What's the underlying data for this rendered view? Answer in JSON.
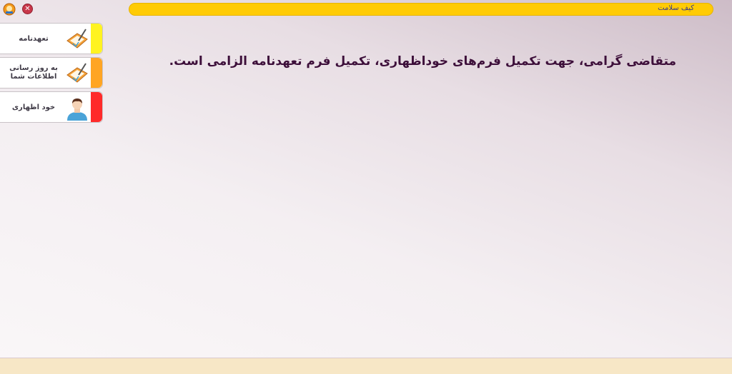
{
  "window": {
    "title": "کیف سلامت"
  },
  "icons": {
    "app": "app-emblem-icon",
    "close": "close-icon"
  },
  "menu": {
    "items": [
      {
        "label": "تعهدنامه",
        "icon": "pen-paper-icon",
        "tab_color": "#fff321"
      },
      {
        "label": "به روز رسانی اطلاعات شما",
        "icon": "pen-paper-icon",
        "tab_color": "#ffa523"
      },
      {
        "label": "خود اظهاری",
        "icon": "user-avatar-icon",
        "tab_color": "#ff2a2a"
      }
    ]
  },
  "main": {
    "message": "متقاضی گرامی، جهت تکمیل فرم‌های خوداظهاری، تکمیل فرم تعهدنامه الزامی است."
  },
  "colors": {
    "topbar": "#ffcb05",
    "headline": "#3d0f3a",
    "footer": "#f7e7c6"
  }
}
